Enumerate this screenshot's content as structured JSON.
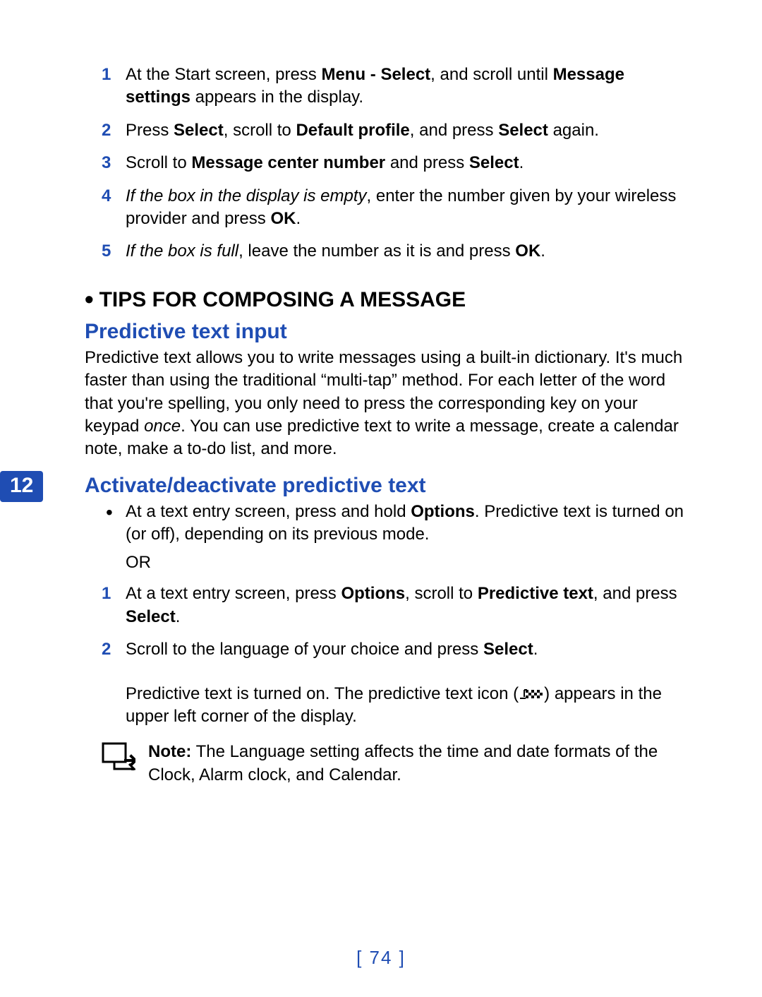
{
  "steps_top": [
    {
      "num": "1",
      "runs": [
        {
          "t": "At the Start screen, press "
        },
        {
          "t": "Menu - Select",
          "b": true
        },
        {
          "t": ", and scroll until "
        },
        {
          "t": "Message settings",
          "b": true
        },
        {
          "t": " appears in the display."
        }
      ]
    },
    {
      "num": "2",
      "runs": [
        {
          "t": "Press "
        },
        {
          "t": "Select",
          "b": true
        },
        {
          "t": ", scroll to "
        },
        {
          "t": "Default profile",
          "b": true
        },
        {
          "t": ", and press "
        },
        {
          "t": "Select",
          "b": true
        },
        {
          "t": " again."
        }
      ]
    },
    {
      "num": "3",
      "runs": [
        {
          "t": "Scroll to "
        },
        {
          "t": "Message center number",
          "b": true
        },
        {
          "t": " and press "
        },
        {
          "t": "Select",
          "b": true
        },
        {
          "t": "."
        }
      ]
    },
    {
      "num": "4",
      "runs": [
        {
          "t": "If the box in the display is empty",
          "i": true
        },
        {
          "t": ", enter the number given by your wireless provider and press "
        },
        {
          "t": "OK",
          "b": true
        },
        {
          "t": "."
        }
      ]
    },
    {
      "num": "5",
      "runs": [
        {
          "t": "If the box is full",
          "i": true
        },
        {
          "t": ", leave the number as it is and press "
        },
        {
          "t": "OK",
          "b": true
        },
        {
          "t": "."
        }
      ]
    }
  ],
  "section_title": "TIPS FOR COMPOSING A MESSAGE",
  "sub1": "Predictive text input",
  "para1_runs": [
    {
      "t": "Predictive text allows you to write messages using a built-in dictionary. It's much faster than using the traditional “multi-tap” method. For each letter of the word that you're spelling, you only need to press the corresponding key on your keypad "
    },
    {
      "t": "once",
      "i": true
    },
    {
      "t": ". You can use predictive text to write a message, create a calendar note, make a to-do list, and more."
    }
  ],
  "chapter_tab": "12",
  "sub2": "Activate/deactivate predictive text",
  "bullet_runs": [
    {
      "t": "At a text entry screen, press and hold "
    },
    {
      "t": "Options",
      "b": true
    },
    {
      "t": ". Predictive text is turned on (or off), depending on its previous mode."
    }
  ],
  "or_label": "OR",
  "steps_bottom": [
    {
      "num": "1",
      "runs": [
        {
          "t": "At a text entry screen, press "
        },
        {
          "t": "Options",
          "b": true
        },
        {
          "t": ", scroll to "
        },
        {
          "t": "Predictive text",
          "b": true
        },
        {
          "t": ", and press "
        },
        {
          "t": "Select",
          "b": true
        },
        {
          "t": "."
        }
      ]
    },
    {
      "num": "2",
      "runs": [
        {
          "t": "Scroll to the language of your choice and press "
        },
        {
          "t": "Select",
          "b": true
        },
        {
          "t": "."
        }
      ]
    }
  ],
  "result_runs": [
    {
      "t": "Predictive text is turned on. The predictive text icon ("
    },
    {
      "icon": "predictive-text-icon"
    },
    {
      "t": ") appears in the upper left corner of the display."
    }
  ],
  "note_runs": [
    {
      "t": "Note:",
      "b": true
    },
    {
      "t": " The Language setting affects the time and date formats of the Clock, Alarm clock, and Calendar."
    }
  ],
  "page_number": "[ 74 ]"
}
